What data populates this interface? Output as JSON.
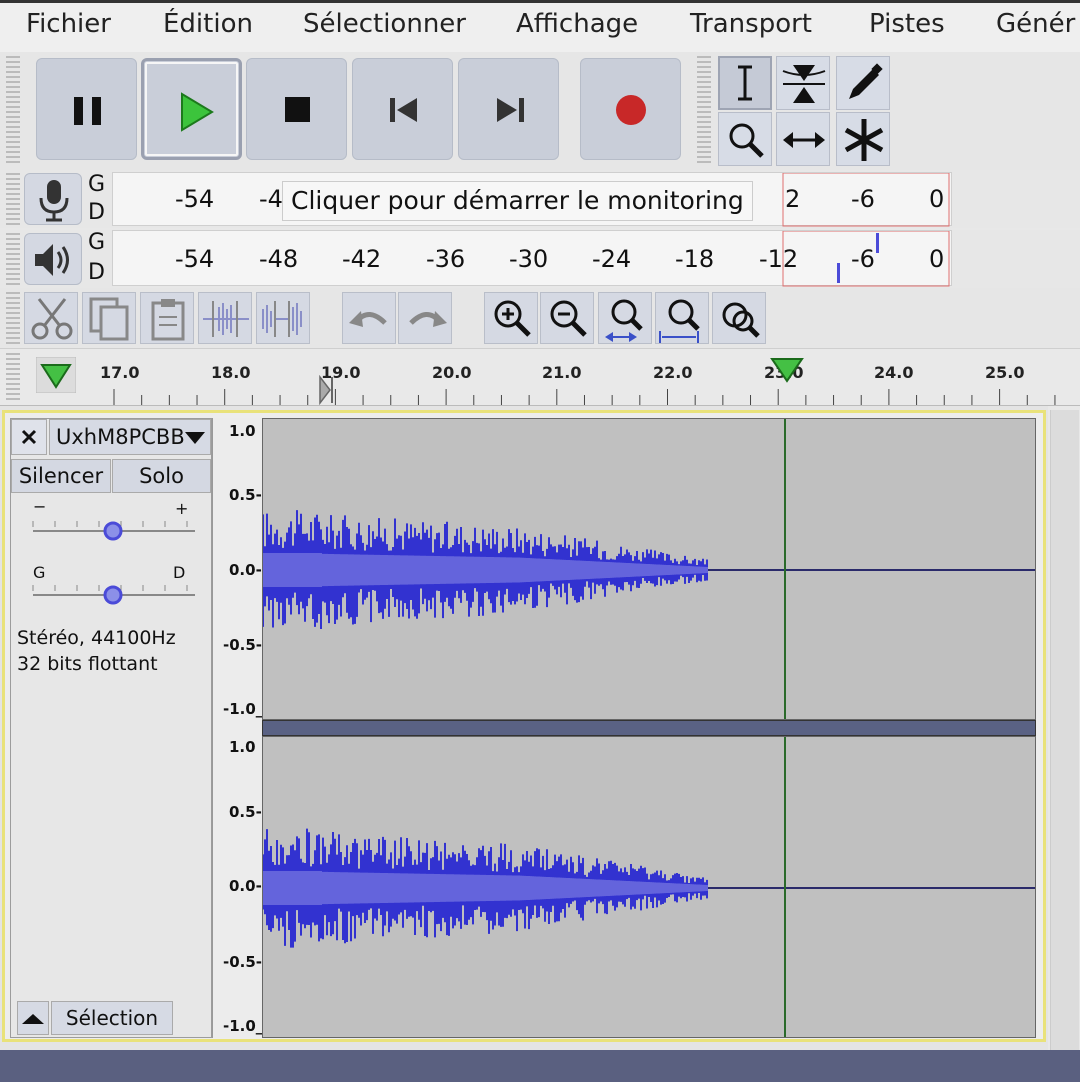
{
  "menu": {
    "items": [
      "Fichier",
      "Édition",
      "Sélectionner",
      "Affichage",
      "Transport",
      "Pistes",
      "Génér"
    ]
  },
  "transport": {
    "buttons": [
      "pause",
      "play",
      "stop",
      "skip-to-start",
      "skip-to-end",
      "record"
    ],
    "active": "play"
  },
  "tools": {
    "items": [
      "selection-tool",
      "envelope-tool",
      "draw-tool",
      "zoom-tool",
      "time-shift-tool",
      "multi-tool"
    ],
    "active": "selection-tool"
  },
  "meters": {
    "record": {
      "left_letter": "G",
      "right_letter": "D",
      "scale": [
        "-54",
        "-4",
        "2",
        "-6",
        "0"
      ],
      "tooltip": "Cliquer pour démarrer le monitoring"
    },
    "playback": {
      "left_letter": "G",
      "right_letter": "D",
      "scale": [
        "-54",
        "-48",
        "-42",
        "-36",
        "-30",
        "-24",
        "-18",
        "-12",
        "-6",
        "0"
      ]
    }
  },
  "edit_toolbar": {
    "items": [
      "cut-icon",
      "copy-icon",
      "paste-icon",
      "trim-icon",
      "silence-icon",
      "undo-icon",
      "redo-icon",
      "zoom-in-icon",
      "zoom-out-icon",
      "fit-selection-icon",
      "fit-project-icon",
      "zoom-toggle-icon"
    ]
  },
  "ruler": {
    "labels": [
      "17.0",
      "18.0",
      "19.0",
      "20.0",
      "21.0",
      "22.0",
      "23.0",
      "24.0",
      "25.0"
    ]
  },
  "track": {
    "name": "UxhM8PCBB",
    "mute_label": "Silencer",
    "solo_label": "Solo",
    "gain_minus": "−",
    "gain_plus": "+",
    "pan_left": "G",
    "pan_right": "D",
    "info_line1": "Stéréo, 44100Hz",
    "info_line2": "32 bits flottant",
    "select_label": "Sélection",
    "scale": [
      "1.0",
      "0.5-",
      "0.0-",
      "-0.5-",
      "-1.0_"
    ]
  },
  "colors": {
    "waveform": "#3232d0",
    "waveform_rms": "#6464dc",
    "track_bg": "#c0c0c0",
    "selected_border": "#e9e27a",
    "play_green": "#3cc43c",
    "record_red": "#c82828"
  }
}
